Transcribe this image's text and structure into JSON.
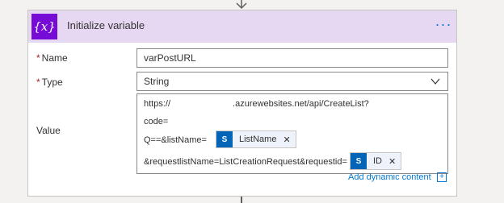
{
  "card": {
    "title": "Initialize variable",
    "icon_glyph": "{x}",
    "icon": "variable-icon",
    "more_label": "···"
  },
  "fields": {
    "name": {
      "label": "Name",
      "value": "varPostURL",
      "required_mark": "*"
    },
    "type": {
      "label": "Type",
      "value": "String",
      "required_mark": "*"
    },
    "value": {
      "label": "Value",
      "line1_start": "https://",
      "line1_end": ".azurewebsites.net/api/CreateList?",
      "line2_start": "code=",
      "line3_start": "Q==&listName=",
      "line4_start": "&requestlistName=ListCreationRequest&requestid=",
      "token1": "ListName",
      "token2": "ID",
      "token_icon_glyph": "S"
    }
  },
  "actions": {
    "add_dynamic_content": "Add dynamic content",
    "add_icon_glyph": "+"
  },
  "colors": {
    "header_bg": "#e6d8f2",
    "icon_bg": "#770bd6",
    "accent": "#0078d4",
    "token_icon_bg": "#0364b8"
  }
}
